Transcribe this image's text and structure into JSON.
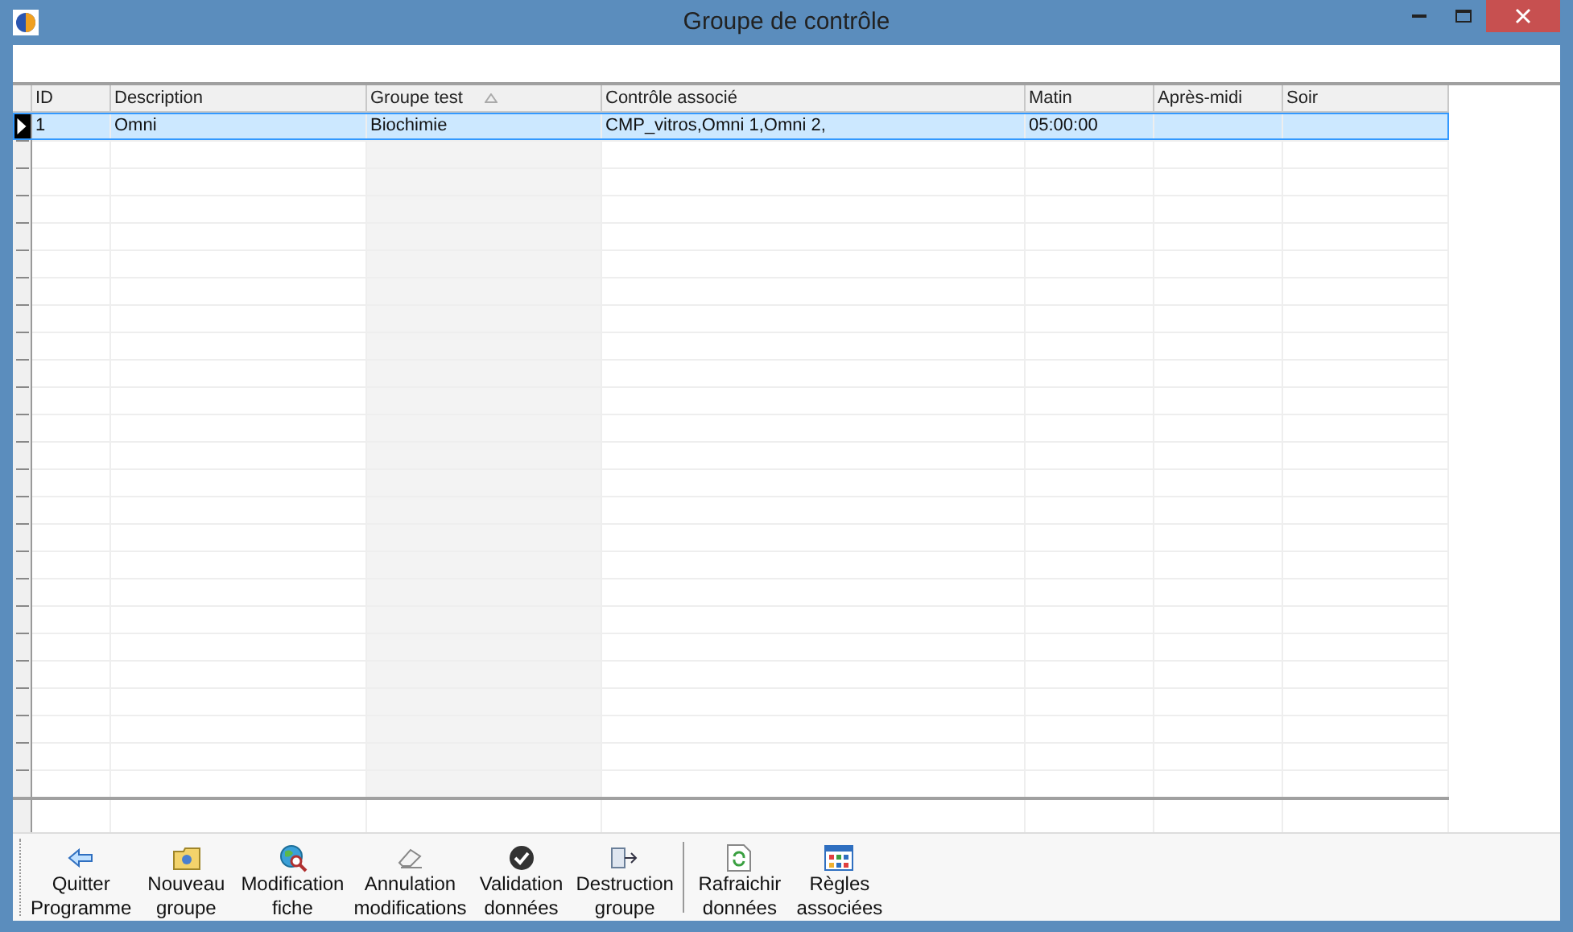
{
  "window": {
    "title": "Groupe de contrôle"
  },
  "grid": {
    "columns": [
      {
        "label": "ID",
        "sorted": false
      },
      {
        "label": "Description",
        "sorted": false
      },
      {
        "label": "Groupe test",
        "sorted": true
      },
      {
        "label": "Contrôle associé",
        "sorted": false
      },
      {
        "label": "Matin",
        "sorted": false
      },
      {
        "label": "Après-midi",
        "sorted": false
      },
      {
        "label": "Soir",
        "sorted": false
      }
    ],
    "rows": [
      {
        "selected": true,
        "cells": [
          "1",
          "Omni",
          "Biochimie",
          "CMP_vitros,Omni 1,Omni 2,",
          "05:00:00",
          "",
          ""
        ]
      }
    ]
  },
  "toolbar": [
    {
      "kind": "back",
      "label": "Quitter\nProgramme",
      "separator_before": false
    },
    {
      "kind": "new-folder",
      "label": "Nouveau\ngroupe",
      "separator_before": false
    },
    {
      "kind": "globe-search",
      "label": "Modification\nfiche",
      "separator_before": false
    },
    {
      "kind": "eraser",
      "label": "Annulation\nmodifications",
      "separator_before": false
    },
    {
      "kind": "check",
      "label": "Validation\ndonnées",
      "separator_before": false
    },
    {
      "kind": "destroy",
      "label": "Destruction\ngroupe",
      "separator_before": false
    },
    {
      "kind": "refresh",
      "label": "Rafraichir\ndonnées",
      "separator_before": true
    },
    {
      "kind": "grid",
      "label": "Règles\nassociées",
      "separator_before": false
    }
  ]
}
